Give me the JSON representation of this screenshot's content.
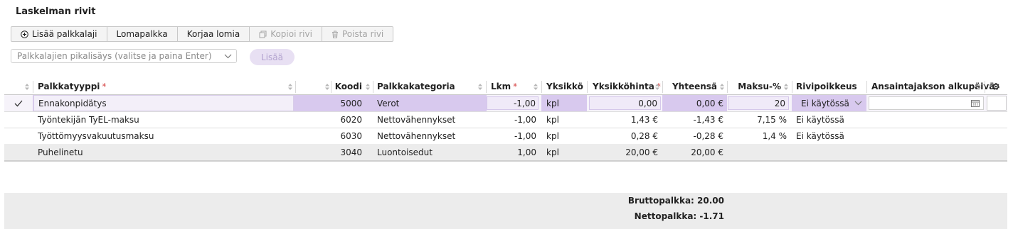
{
  "title": "Laskelman rivit",
  "toolbar": {
    "add_label": "Lisää palkkalaji",
    "holiday_pay_label": "Lomapalkka",
    "fix_holiday_label": "Korjaa lomia",
    "copy_label": "Kopioi rivi",
    "delete_label": "Poista rivi"
  },
  "quick_add": {
    "placeholder": "Palkkalajien pikalisäys (valitse ja paina Enter)",
    "button_label": "Lisää"
  },
  "columns": {
    "type": "Palkkatyyppi",
    "code": "Koodi",
    "category": "Palkkakategoria",
    "qty": "Lkm",
    "unit": "Yksikkö",
    "unit_price": "Yksikköhinta",
    "total": "Yhteensä",
    "pct": "Maksu-%",
    "exception": "Rivipoikkeus",
    "period_start": "Ansaintajakson alkupäivä"
  },
  "rows": [
    {
      "type": "Ennakonpidätys",
      "code": "5000",
      "category": "Verot",
      "qty": "-1,00",
      "unit": "kpl",
      "unit_price": "0,00",
      "total": "0,00 €",
      "pct": "20",
      "exception": "Ei käytössä",
      "selected": true
    },
    {
      "type": "Työntekijän TyEL-maksu",
      "code": "6020",
      "category": "Nettovähennykset",
      "qty": "-1,00",
      "unit": "kpl",
      "unit_price": "1,43 €",
      "total": "-1,43 €",
      "pct": "7,15 %",
      "exception": "Ei käytössä"
    },
    {
      "type": "Työttömyysvakuutusmaksu",
      "code": "6030",
      "category": "Nettovähennykset",
      "qty": "-1,00",
      "unit": "kpl",
      "unit_price": "0,28 €",
      "total": "-0,28 €",
      "pct": "1,4 %",
      "exception": "Ei käytössä"
    },
    {
      "type": "Puhelinetu",
      "code": "3040",
      "category": "Luontoisedut",
      "qty": "1,00",
      "unit": "kpl",
      "unit_price": "20,00 €",
      "total": "20,00 €",
      "pct": "",
      "exception": ""
    }
  ],
  "totals": {
    "gross": "Bruttopalkka: 20.00",
    "net": "Nettopalkka: -1.71"
  },
  "colors": {
    "selected_row": "#d8c9ee",
    "input_bg": "#f0eaf8",
    "required": "#d64545",
    "footer_bg": "#ececec"
  }
}
